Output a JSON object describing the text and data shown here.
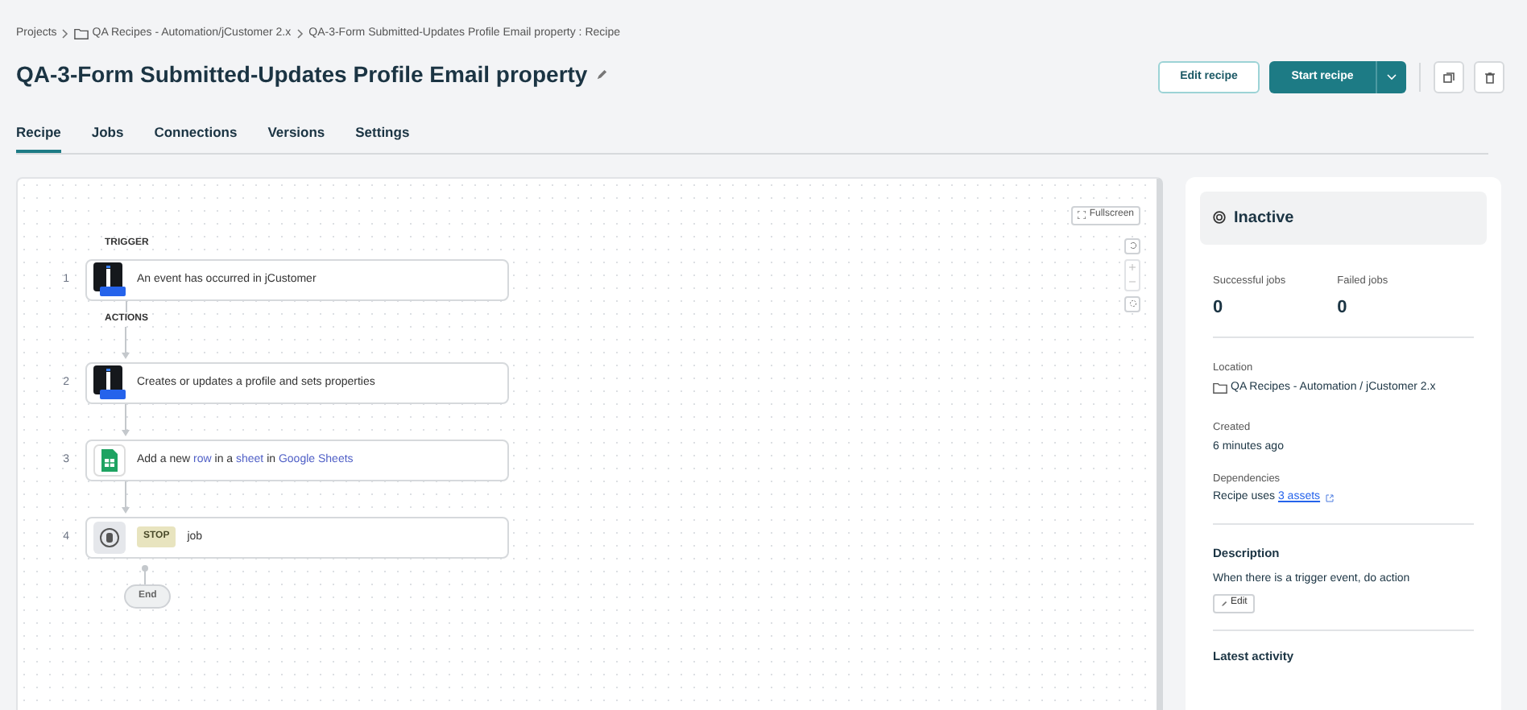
{
  "breadcrumb": [
    {
      "text": "Projects",
      "kind": "plain"
    },
    {
      "text": "QA Recipes - Automation/jCustomer 2.x",
      "kind": "folder"
    },
    {
      "text": "QA-3-Form Submitted-Updates Profile Email property : Recipe",
      "kind": "plain"
    }
  ],
  "title": "QA-3-Form Submitted-Updates Profile Email property",
  "buttons": {
    "edit": "Edit recipe",
    "start": "Start recipe"
  },
  "tabs": [
    {
      "label": "Recipe",
      "selected": true
    },
    {
      "label": "Jobs",
      "selected": false
    },
    {
      "label": "Connections",
      "selected": false
    },
    {
      "label": "Versions",
      "selected": false
    },
    {
      "label": "Settings",
      "selected": false
    }
  ],
  "canvas": {
    "fullscreen": "Fullscreen",
    "trigger_label": "TRIGGER",
    "actions_label": "ACTIONS",
    "end": "End",
    "steps": [
      {
        "number": "1",
        "kind": "jcustomer",
        "parts": [
          {
            "text": "An event has occurred in jCustomer",
            "kind": "text"
          }
        ]
      },
      {
        "number": "2",
        "kind": "jcustomer",
        "parts": [
          {
            "text": "Creates or updates a profile and sets properties",
            "kind": "text"
          }
        ]
      },
      {
        "number": "3",
        "kind": "sheets",
        "parts": [
          {
            "text": "Add a new ",
            "kind": "text"
          },
          {
            "text": "row",
            "kind": "link"
          },
          {
            "text": " in a ",
            "kind": "text"
          },
          {
            "text": "sheet",
            "kind": "link"
          },
          {
            "text": " in ",
            "kind": "text"
          },
          {
            "text": "Google Sheets",
            "kind": "link"
          }
        ]
      },
      {
        "number": "4",
        "kind": "stop",
        "badge": "STOP",
        "parts": [
          {
            "text": "job",
            "kind": "text"
          }
        ]
      }
    ]
  },
  "status": {
    "label": "Inactive",
    "active": false
  },
  "stats": [
    {
      "label": "Successful jobs",
      "value": "0"
    },
    {
      "label": "Failed jobs",
      "value": "0"
    }
  ],
  "location": {
    "label": "Location",
    "value": "QA Recipes - Automation / jCustomer 2.x"
  },
  "created": {
    "label": "Created",
    "value": "6 minutes ago"
  },
  "dependencies": {
    "label": "Dependencies",
    "prefix": "Recipe uses ",
    "link": "3 assets"
  },
  "description": {
    "heading": "Description",
    "text": "When there is a trigger event, do action",
    "edit": "Edit"
  },
  "latest_activity": "Latest activity"
}
